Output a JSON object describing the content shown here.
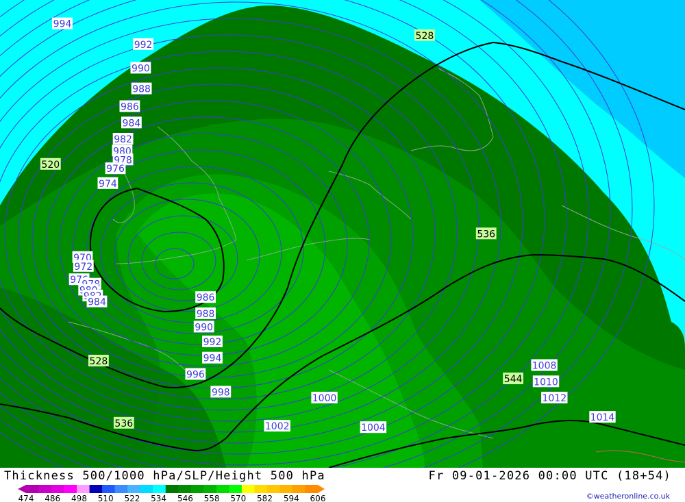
{
  "title": "Thickness 500/1000 hPa/SLP/Height 500 hPa",
  "datetime": "Fr 09-01-2026 00:00 UTC (18+54)",
  "credit": "©weatheronline.co.uk",
  "legend": {
    "ticks": [
      "474",
      "486",
      "498",
      "510",
      "522",
      "534",
      "546",
      "558",
      "570",
      "582",
      "594",
      "606"
    ],
    "colors": [
      "#b000b0",
      "#c800c8",
      "#e000e0",
      "#ff00ff",
      "#ff9cff",
      "#0000b4",
      "#1e5aff",
      "#3c8cff",
      "#46b4ff",
      "#00dcff",
      "#00ffff",
      "#007800",
      "#008c00",
      "#00a000",
      "#00b400",
      "#00dc00",
      "#00ff00",
      "#ffff00",
      "#ffdc00",
      "#ffc800",
      "#ffb400",
      "#ffa000",
      "#ff8c00"
    ]
  },
  "map": {
    "fill_colors": {
      "cyan": "#00ffff",
      "light_blue": "#00ccff",
      "dark_green": "#007800",
      "green_534": "#008c00",
      "green_540": "#00a000",
      "green_546": "#00b400"
    },
    "isobar_labels": [
      {
        "text": "994",
        "lon": -22.6,
        "lat": 61.4
      },
      {
        "text": "992",
        "lon": -13.0,
        "lat": 60.0
      },
      {
        "text": "990",
        "lon": -13.3,
        "lat": 58.4
      },
      {
        "text": "988",
        "lon": -13.2,
        "lat": 57.0
      },
      {
        "text": "986",
        "lon": -14.6,
        "lat": 55.8
      },
      {
        "text": "984",
        "lon": -14.4,
        "lat": 54.7
      },
      {
        "text": "982",
        "lon": -15.4,
        "lat": 53.6
      },
      {
        "text": "980",
        "lon": -15.5,
        "lat": 52.8
      },
      {
        "text": "978",
        "lon": -15.4,
        "lat": 52.2
      },
      {
        "text": "976",
        "lon": -16.3,
        "lat": 51.6
      },
      {
        "text": "974",
        "lon": -17.2,
        "lat": 50.6
      },
      {
        "text": "970",
        "lon": -20.2,
        "lat": 45.6
      },
      {
        "text": "972",
        "lon": -20.1,
        "lat": 45.0
      },
      {
        "text": "976",
        "lon": -20.6,
        "lat": 44.1
      },
      {
        "text": "978",
        "lon": -19.2,
        "lat": 43.8
      },
      {
        "text": "980",
        "lon": -19.5,
        "lat": 43.4
      },
      {
        "text": "982",
        "lon": -19.0,
        "lat": 43.0
      },
      {
        "text": "984",
        "lon": -18.5,
        "lat": 42.6
      },
      {
        "text": "986",
        "lon": -5.6,
        "lat": 42.9
      },
      {
        "text": "988",
        "lon": -5.6,
        "lat": 41.8
      },
      {
        "text": "990",
        "lon": -5.8,
        "lat": 40.9
      },
      {
        "text": "992",
        "lon": -4.8,
        "lat": 39.9
      },
      {
        "text": "994",
        "lon": -4.8,
        "lat": 38.8
      },
      {
        "text": "996",
        "lon": -6.8,
        "lat": 37.7
      },
      {
        "text": "998",
        "lon": -3.8,
        "lat": 36.5
      },
      {
        "text": "1000",
        "lon": 8.5,
        "lat": 36.1
      },
      {
        "text": "1002",
        "lon": 2.9,
        "lat": 34.2
      },
      {
        "text": "1004",
        "lon": 14.3,
        "lat": 34.1
      },
      {
        "text": "1008",
        "lon": 34.6,
        "lat": 38.3
      },
      {
        "text": "1010",
        "lon": 34.8,
        "lat": 37.2
      },
      {
        "text": "1012",
        "lon": 35.8,
        "lat": 36.1
      },
      {
        "text": "1014",
        "lon": 41.5,
        "lat": 34.8
      }
    ],
    "thickness_labels": [
      {
        "text": "520",
        "lon": -24.0,
        "lat": 51.9
      },
      {
        "text": "528",
        "lon": 20.4,
        "lat": 60.6
      },
      {
        "text": "528",
        "lon": -18.3,
        "lat": 38.6
      },
      {
        "text": "536",
        "lon": 27.7,
        "lat": 47.2
      },
      {
        "text": "536",
        "lon": -15.3,
        "lat": 34.4
      },
      {
        "text": "544",
        "lon": 30.9,
        "lat": 37.4
      }
    ]
  }
}
